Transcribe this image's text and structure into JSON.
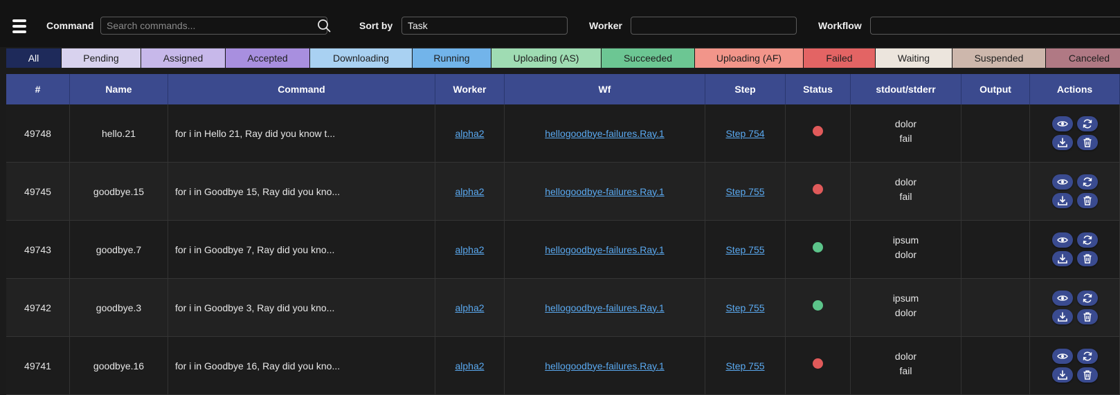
{
  "filters": {
    "command_label": "Command",
    "command_placeholder": "Search commands...",
    "sort_label": "Sort by",
    "sort_value": "Task",
    "worker_label": "Worker",
    "worker_value": "",
    "workflow_label": "Workflow",
    "workflow_value": ""
  },
  "status_chips": [
    {
      "label": "All",
      "color": "#1e2a5a"
    },
    {
      "label": "Pending",
      "color": "#d8d2ee"
    },
    {
      "label": "Assigned",
      "color": "#c7b8ea"
    },
    {
      "label": "Accepted",
      "color": "#a88fdf"
    },
    {
      "label": "Downloading",
      "color": "#a9d1f2"
    },
    {
      "label": "Running",
      "color": "#72b4ea"
    },
    {
      "label": "Uploading (AS)",
      "color": "#9fdcb3"
    },
    {
      "label": "Succeeded",
      "color": "#6cc693"
    },
    {
      "label": "Uploading (AF)",
      "color": "#f2958a"
    },
    {
      "label": "Failed",
      "color": "#e36464"
    },
    {
      "label": "Waiting",
      "color": "#ece5dd"
    },
    {
      "label": "Suspended",
      "color": "#cdb7ac"
    },
    {
      "label": "Canceled",
      "color": "#b07984"
    }
  ],
  "table": {
    "headers": [
      "#",
      "Name",
      "Command",
      "Worker",
      "Wf",
      "Step",
      "Status",
      "stdout/stderr",
      "Output",
      "Actions"
    ],
    "rows": [
      {
        "id": "49748",
        "name": "hello.21",
        "command": "for i in Hello 21, Ray did you know t...",
        "worker": "alpha2",
        "wf": "hellogoodbye-failures.Ray.1",
        "step": "Step 754",
        "status_color": "#e05a5a",
        "stdout": "dolor",
        "stderr": "fail",
        "output": ""
      },
      {
        "id": "49745",
        "name": "goodbye.15",
        "command": "for i in Goodbye 15, Ray did you kno...",
        "worker": "alpha2",
        "wf": "hellogoodbye-failures.Ray.1",
        "step": "Step 755",
        "status_color": "#e05a5a",
        "stdout": "dolor",
        "stderr": "fail",
        "output": ""
      },
      {
        "id": "49743",
        "name": "goodbye.7",
        "command": "for i in Goodbye 7, Ray did you kno...",
        "worker": "alpha2",
        "wf": "hellogoodbye-failures.Ray.1",
        "step": "Step 755",
        "status_color": "#5cc48a",
        "stdout": "ipsum",
        "stderr": "dolor",
        "output": ""
      },
      {
        "id": "49742",
        "name": "goodbye.3",
        "command": "for i in Goodbye 3, Ray did you kno...",
        "worker": "alpha2",
        "wf": "hellogoodbye-failures.Ray.1",
        "step": "Step 755",
        "status_color": "#5cc48a",
        "stdout": "ipsum",
        "stderr": "dolor",
        "output": ""
      },
      {
        "id": "49741",
        "name": "goodbye.16",
        "command": "for i in Goodbye 16, Ray did you kno...",
        "worker": "alpha2",
        "wf": "hellogoodbye-failures.Ray.1",
        "step": "Step 755",
        "status_color": "#e05a5a",
        "stdout": "dolor",
        "stderr": "fail",
        "output": ""
      }
    ],
    "action_icons": [
      "eye-icon",
      "refresh-icon",
      "download-icon",
      "trash-icon"
    ]
  }
}
